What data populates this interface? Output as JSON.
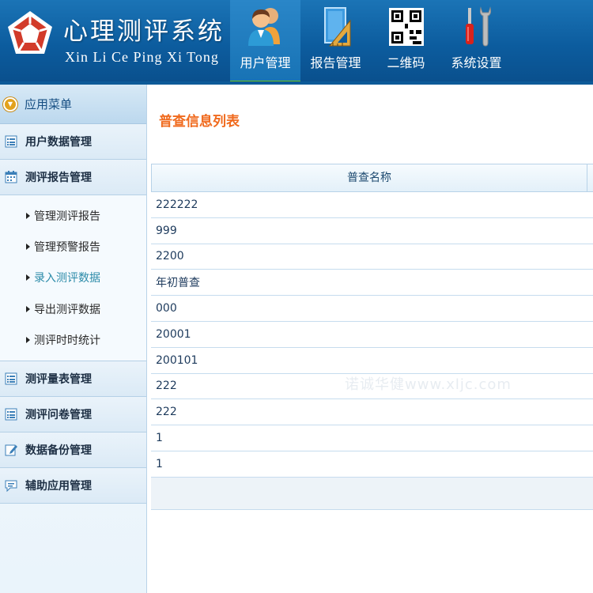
{
  "header": {
    "title": "心理测评系统",
    "subtitle": "Xin Li Ce Ping Xi Tong",
    "nav": [
      {
        "label": "用户管理",
        "icon": "users-icon",
        "active": true
      },
      {
        "label": "报告管理",
        "icon": "report-ruler-icon",
        "active": false
      },
      {
        "label": "二维码",
        "icon": "qr-code-icon",
        "active": false
      },
      {
        "label": "系统设置",
        "icon": "tools-icon",
        "active": false
      }
    ],
    "accent_active": "#6fc41f"
  },
  "sidebar": {
    "head": "应用菜单",
    "items": [
      {
        "label": "用户数据管理",
        "icon": "list-icon"
      },
      {
        "label": "测评报告管理",
        "icon": "calendar-icon"
      },
      {
        "label": "测评量表管理",
        "icon": "list-icon"
      },
      {
        "label": "测评问卷管理",
        "icon": "list-icon"
      },
      {
        "label": "数据备份管理",
        "icon": "edit-icon"
      },
      {
        "label": "辅助应用管理",
        "icon": "comment-icon"
      }
    ],
    "subitems": [
      {
        "label": "管理测评报告"
      },
      {
        "label": "管理预警报告"
      },
      {
        "label": "录入测评数据",
        "current": true
      },
      {
        "label": "导出测评数据"
      },
      {
        "label": "测评时时统计"
      }
    ]
  },
  "main": {
    "title": "普查信息列表",
    "column_header": "普查名称",
    "rows": [
      "222222",
      "999",
      "2200",
      "年初普查",
      "000",
      "20001",
      "200101",
      "222",
      "222",
      "1",
      "1"
    ],
    "title_color": "#f06a1d"
  },
  "watermark": "诺诚华健www.xljc.com"
}
